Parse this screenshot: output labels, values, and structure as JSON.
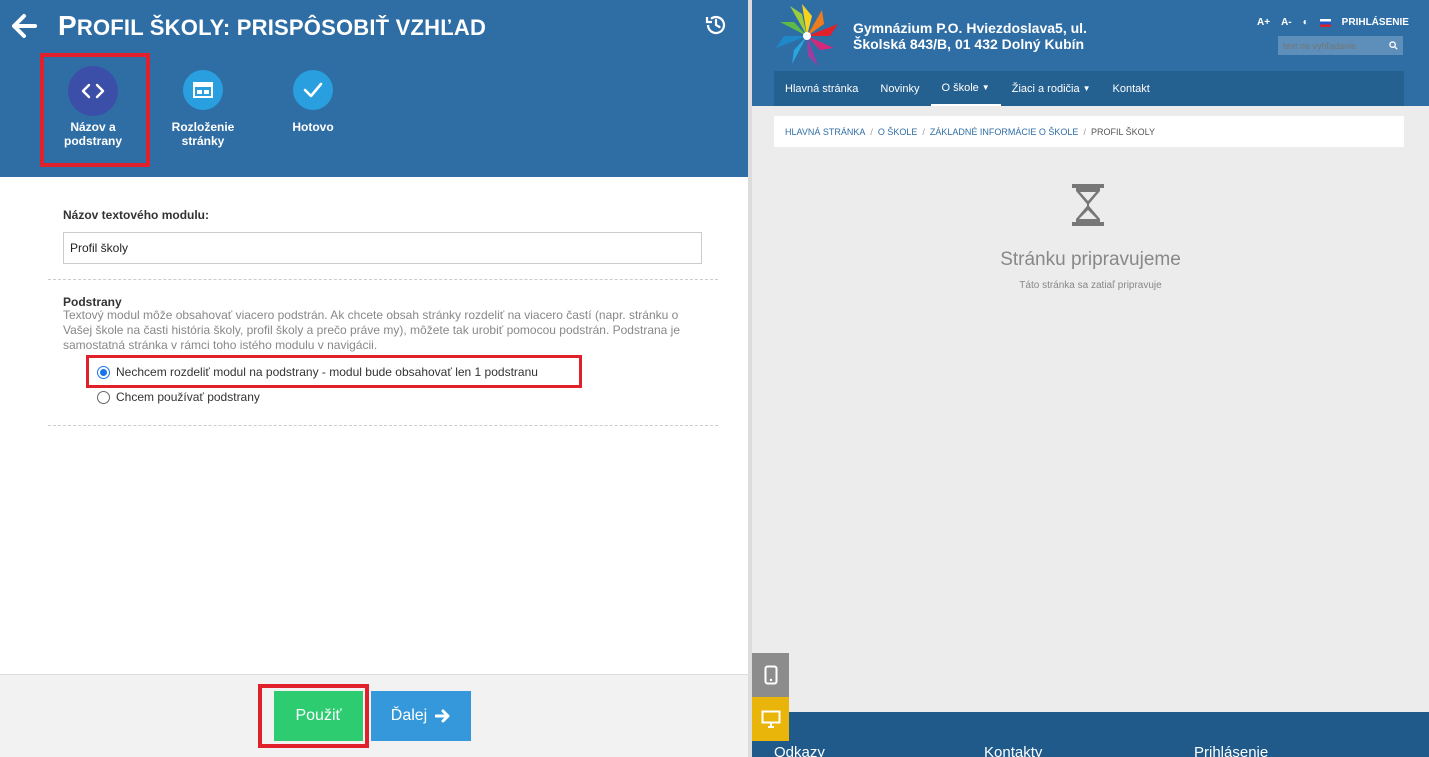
{
  "editor": {
    "title_first": "P",
    "title_rest": "ROFIL ŠKOLY: PRISPÔSOBIŤ VZHĽAD",
    "steps": [
      {
        "label_line1": "Názov a",
        "label_line2": "podstrany",
        "icon": "code-icon"
      },
      {
        "label_line1": "Rozloženie",
        "label_line2": "stránky",
        "icon": "layout-icon"
      },
      {
        "label_line1": "Hotovo",
        "label_line2": "",
        "icon": "check-icon"
      }
    ],
    "module_name_label": "Názov textového modulu:",
    "module_name_value": "Profil školy",
    "subpages_label": "Podstrany",
    "subpages_description": "Textový modul môže obsahovať viacero podstrán. Ak chcete obsah stránky rozdeliť na viacero častí (napr. stránku o Vašej škole na časti história školy, profil školy a prečo práve my), môžete tak urobiť pomocou podstrán. Podstrana je samostatná stránka v rámci toho istého modulu v navigácii.",
    "radio_options": [
      {
        "label": "Nechcem rozdeliť modul na podstrany - modul bude obsahovať len 1 podstranu",
        "selected": true
      },
      {
        "label": "Chcem používať podstrany",
        "selected": false
      }
    ],
    "apply_label": "Použiť",
    "next_label": "Ďalej"
  },
  "preview": {
    "school_name_line1": "Gymnázium P.O. Hviezdoslava5, ul.",
    "school_name_line2": "Školská 843/B, 01 432 Dolný Kubín",
    "tools": {
      "font_up": "A+",
      "font_down": "A-",
      "contrast": "◐",
      "login": "PRIHLÁSENIE"
    },
    "search_placeholder": "text na vyhľadanie",
    "nav": [
      {
        "label": "Hlavná stránka",
        "dropdown": false
      },
      {
        "label": "Novinky",
        "dropdown": false
      },
      {
        "label": "O škole",
        "dropdown": true
      },
      {
        "label": "Žiaci a rodičia",
        "dropdown": true
      },
      {
        "label": "Kontakt",
        "dropdown": false
      }
    ],
    "breadcrumb": [
      "HLAVNÁ STRÁNKA",
      "O ŠKOLE",
      "ZÁKLADNÉ INFORMÁCIE O ŠKOLE"
    ],
    "breadcrumb_current": "PROFIL ŠKOLY",
    "preparing_title": "Stránku pripravujeme",
    "preparing_subtitle": "Táto stránka sa zatiaľ pripravuje",
    "footer_columns": [
      "Odkazy",
      "Kontakty",
      "Prihlásenie"
    ]
  },
  "colors": {
    "header_blue": "#2f6ea5",
    "nav_blue": "#246090",
    "active_step": "#3c4fa8",
    "step_blue": "#2a9fe0",
    "apply_green": "#2ecc71",
    "next_blue": "#3498db",
    "highlight_red": "#e0202a",
    "desktop_yellow": "#e9b50b"
  }
}
